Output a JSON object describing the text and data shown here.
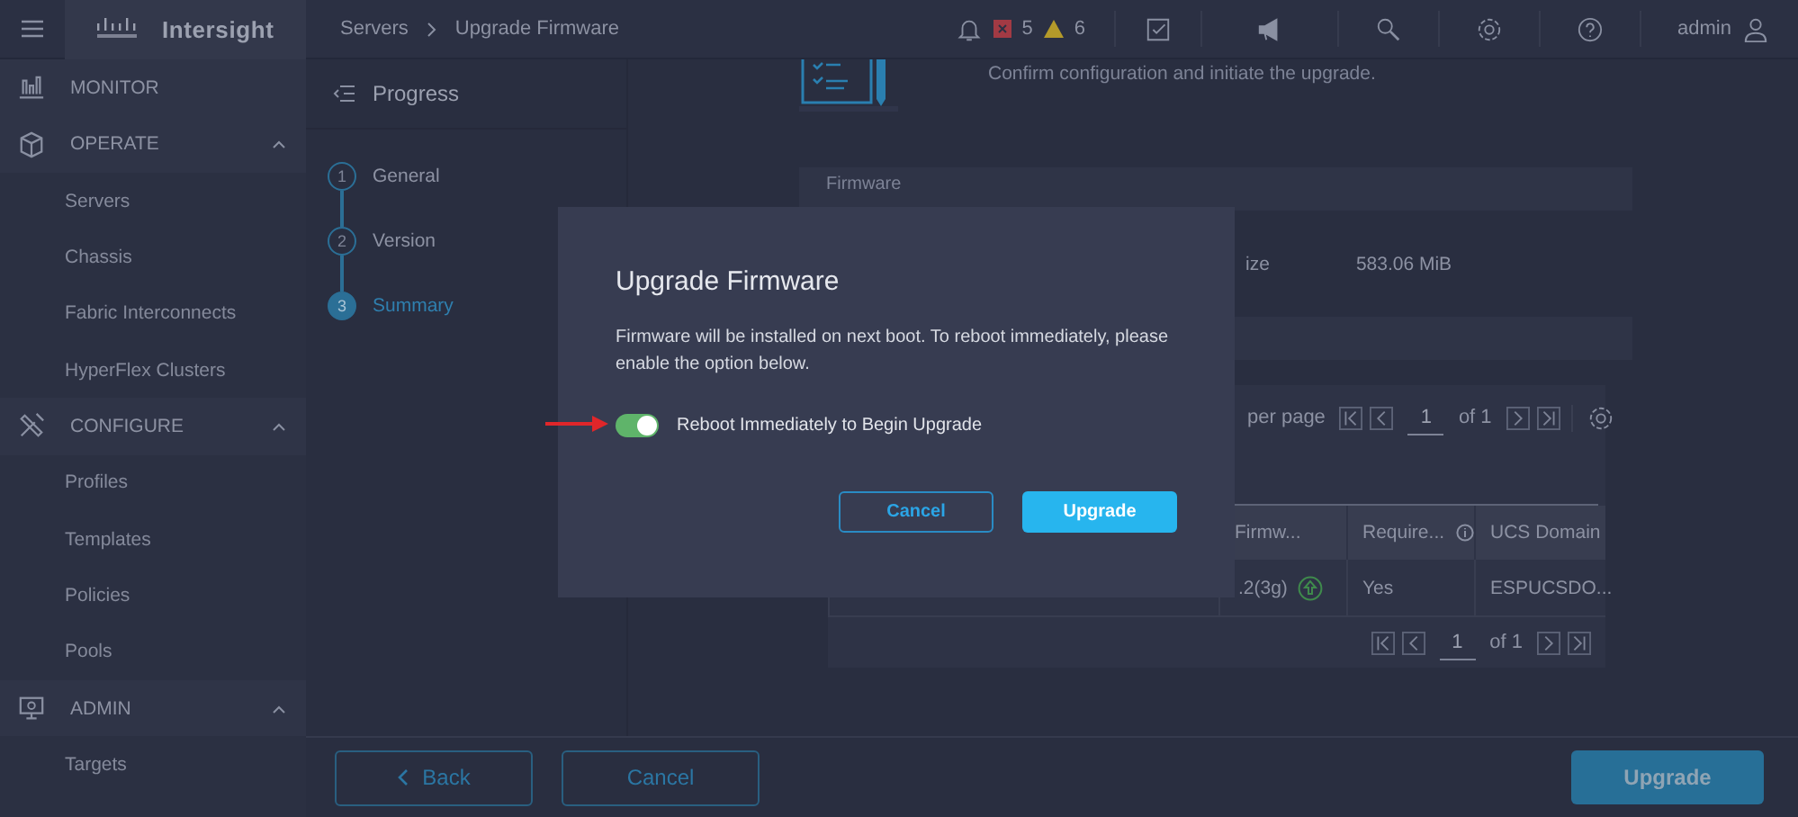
{
  "topbar": {
    "brand": "Intersight",
    "breadcrumb": [
      "Servers",
      "Upgrade Firmware"
    ],
    "critical_count": "5",
    "warning_count": "6",
    "user": "admin"
  },
  "sidebar": {
    "sections": [
      {
        "label": "MONITOR"
      },
      {
        "label": "OPERATE",
        "expandable": true,
        "expanded": true,
        "items": [
          "Servers",
          "Chassis",
          "Fabric Interconnects",
          "HyperFlex Clusters"
        ]
      },
      {
        "label": "CONFIGURE",
        "expandable": true,
        "expanded": true,
        "items": [
          "Profiles",
          "Templates",
          "Policies",
          "Pools"
        ]
      },
      {
        "label": "ADMIN",
        "expandable": true,
        "expanded": true,
        "items": [
          "Targets"
        ]
      }
    ]
  },
  "progress": {
    "title": "Progress",
    "steps": [
      {
        "number": "1",
        "label": "General",
        "selected": false
      },
      {
        "number": "2",
        "label": "Version",
        "selected": false
      },
      {
        "number": "3",
        "label": "Summary",
        "selected": true
      }
    ]
  },
  "summary": {
    "description": "Confirm configuration and initiate the upgrade.",
    "section_title": "Firmware",
    "size_label": "ize",
    "size_value": "583.06 MiB"
  },
  "table": {
    "per_page_label": "per page",
    "page": "1",
    "page_total": "of 1",
    "columns": [
      "Firmw...",
      "Require...",
      "UCS Domain"
    ],
    "rows": [
      {
        "firmware": ".2(3g)",
        "required": "Yes",
        "domain": "ESPUCSDO..."
      }
    ],
    "footer_page": "1",
    "footer_total": "of 1"
  },
  "footer": {
    "back": "Back",
    "cancel": "Cancel",
    "upgrade": "Upgrade"
  },
  "dialog": {
    "title": "Upgrade Firmware",
    "message": "Firmware will be installed on next boot. To reboot immediately, please enable the option below.",
    "toggle_label": "Reboot Immediately to Begin Upgrade",
    "toggle_on": true,
    "cancel": "Cancel",
    "confirm": "Upgrade"
  }
}
